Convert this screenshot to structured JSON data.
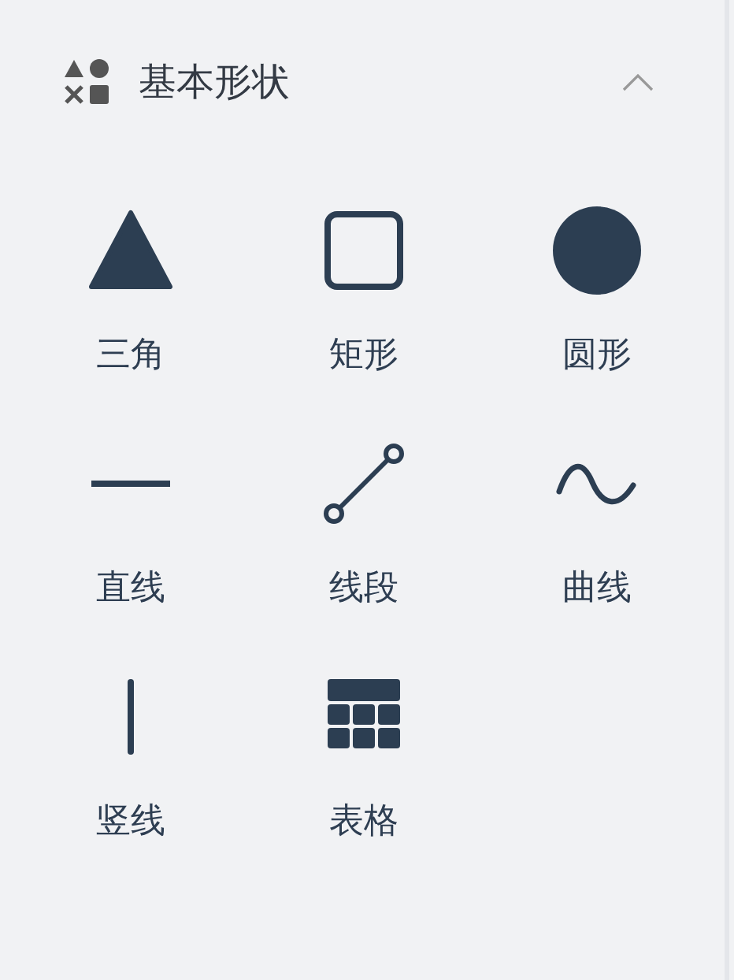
{
  "section": {
    "title": "基本形状",
    "expanded": true,
    "shapes": [
      {
        "kind": "triangle",
        "label": "三角"
      },
      {
        "kind": "rectangle",
        "label": "矩形"
      },
      {
        "kind": "circle",
        "label": "圆形"
      },
      {
        "kind": "line",
        "label": "直线"
      },
      {
        "kind": "segment",
        "label": "线段"
      },
      {
        "kind": "curve",
        "label": "曲线"
      },
      {
        "kind": "vertical",
        "label": "竖线"
      },
      {
        "kind": "table",
        "label": "表格"
      }
    ]
  }
}
